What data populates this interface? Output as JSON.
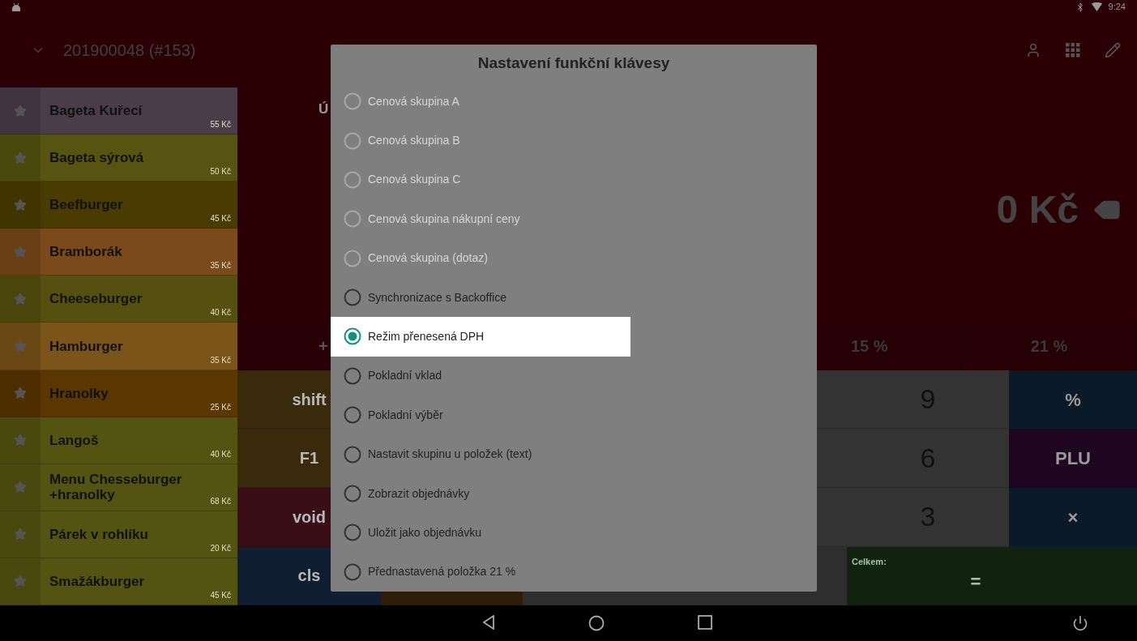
{
  "status_bar": {
    "time": "9:24"
  },
  "header": {
    "title": "201900048 (#153)"
  },
  "products": [
    {
      "name": "Bageta Kuřecí",
      "price": "55 Kč",
      "color": "#4a3c48"
    },
    {
      "name": "Bageta sýrová",
      "price": "50 Kč",
      "color": "#565410"
    },
    {
      "name": "Beefburger",
      "price": "45 Kč",
      "color": "#4a3c00"
    },
    {
      "name": "Bramborák",
      "price": "35 Kč",
      "color": "#7a4a1a"
    },
    {
      "name": "Cheeseburger",
      "price": "40 Kč",
      "color": "#565010"
    },
    {
      "name": "Hamburger",
      "price": "35 Kč",
      "color": "#7a5418"
    },
    {
      "name": "Hranolky",
      "price": "25 Kč",
      "color": "#5a3600"
    },
    {
      "name": "Langoš",
      "price": "40 Kč",
      "color": "#545412"
    },
    {
      "name": "Menu Chesseburger +hranolky",
      "price": "68 Kč",
      "color": "#545412"
    },
    {
      "name": "Párek v rohlíku",
      "price": "20 Kč",
      "color": "#545412"
    },
    {
      "name": "Smažákburger",
      "price": "45 Kč",
      "color": "#545412"
    }
  ],
  "display": {
    "partial_label": "Ú",
    "amount": "0 Kč"
  },
  "tax_buttons": [
    {
      "label": "+"
    },
    {
      "label": "15 %"
    },
    {
      "label": "21 %"
    }
  ],
  "function_keys": [
    {
      "label": "shift",
      "color": "#3a2a0c"
    },
    {
      "label": "F1",
      "color": "#3a2a0c"
    },
    {
      "label": "void",
      "color": "#3a0e16"
    },
    {
      "label": "cls",
      "color": "#0f1e30"
    }
  ],
  "digit_keys": [
    "9",
    "6",
    "3"
  ],
  "operator_keys": [
    {
      "label": "%",
      "color": "#0b1a28"
    },
    {
      "label": "PLU",
      "color": "#1e0620"
    },
    {
      "label": "×",
      "color": "#0b1a28"
    }
  ],
  "total": {
    "label": "Celkem:",
    "key": "="
  },
  "dialog": {
    "title": "Nastavení funkční klávesy",
    "options": [
      {
        "label": "Cenová skupina A",
        "disabled": true,
        "selected": false
      },
      {
        "label": "Cenová skupina B",
        "disabled": true,
        "selected": false
      },
      {
        "label": "Cenová skupina C",
        "disabled": true,
        "selected": false
      },
      {
        "label": "Cenová skupina nákupní ceny",
        "disabled": true,
        "selected": false
      },
      {
        "label": "Cenová skupina (dotaz)",
        "disabled": true,
        "selected": false
      },
      {
        "label": "Synchronizace s Backoffice",
        "disabled": false,
        "selected": false
      },
      {
        "label": "Režim přenesená DPH",
        "disabled": false,
        "selected": true
      },
      {
        "label": "Pokladní vklad",
        "disabled": false,
        "selected": false
      },
      {
        "label": "Pokladní výběr",
        "disabled": false,
        "selected": false
      },
      {
        "label": "Nastavit skupinu u položek (text)",
        "disabled": false,
        "selected": false
      },
      {
        "label": "Zobrazit objednávky",
        "disabled": false,
        "selected": false
      },
      {
        "label": "Uložit jako objednávku",
        "disabled": false,
        "selected": false
      },
      {
        "label": "Přednastavená položka 21 %",
        "disabled": false,
        "selected": false
      }
    ]
  }
}
